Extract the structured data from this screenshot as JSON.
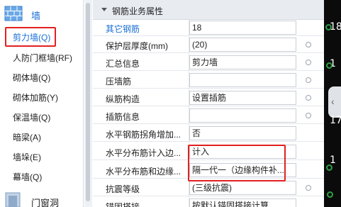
{
  "left_panel": {
    "top_category": {
      "label": "墙",
      "icon": "brick-wall-icon"
    },
    "items": [
      {
        "label": "剪力墙(Q)",
        "selected": true
      },
      {
        "label": "人防门框墙(RF)",
        "selected": false
      },
      {
        "label": "砌体墙(Q)",
        "selected": false
      },
      {
        "label": "砌体加筋(Y)",
        "selected": false
      },
      {
        "label": "保温墙(Q)",
        "selected": false
      },
      {
        "label": "暗梁(A)",
        "selected": false
      },
      {
        "label": "墙垛(E)",
        "selected": false
      },
      {
        "label": "幕墙(Q)",
        "selected": false
      }
    ],
    "bottom_category": {
      "label": "门窗洞",
      "icon": "door-window-icon"
    }
  },
  "properties_panel": {
    "section_title": "钢筋业务属性",
    "rows": [
      {
        "label": "其它钢筋",
        "value": "18",
        "highlight_label": true,
        "has_dot": false
      },
      {
        "label": "保护层厚度(mm)",
        "value": "(20)",
        "highlight_label": false,
        "has_dot": true
      },
      {
        "label": "汇总信息",
        "value": "剪力墙",
        "highlight_label": false,
        "has_dot": true
      },
      {
        "label": "压墙筋",
        "value": "",
        "highlight_label": false,
        "has_dot": true
      },
      {
        "label": "纵筋构造",
        "value": "设置插筋",
        "highlight_label": false,
        "has_dot": true
      },
      {
        "label": "插筋信息",
        "value": "",
        "highlight_label": false,
        "has_dot": true
      },
      {
        "label": "水平钢筋拐角增加...",
        "value": "否",
        "highlight_label": false,
        "has_dot": false
      },
      {
        "label": "水平分布筋计入边...",
        "value": "计入",
        "highlight_label": false,
        "has_dot": false
      },
      {
        "label": "水平分布筋和边缘...",
        "value": "隔一代一（边缘构件补...",
        "highlight_label": false,
        "has_dot": false
      },
      {
        "label": "抗震等级",
        "value": "(三级抗震)",
        "highlight_label": false,
        "has_dot": true
      },
      {
        "label": "锚固搭接",
        "value": "按默认锚固搭接计算",
        "highlight_label": false,
        "has_dot": false
      }
    ]
  },
  "viewport": {
    "labels": [
      "18",
      "1",
      "1",
      "17"
    ],
    "collapse_glyph": "‹"
  },
  "colors": {
    "accent": "#1a6fd6",
    "highlight_box": "#e32020",
    "viewport_bg": "#0b0b0b",
    "node_ring": "#2ea043"
  }
}
